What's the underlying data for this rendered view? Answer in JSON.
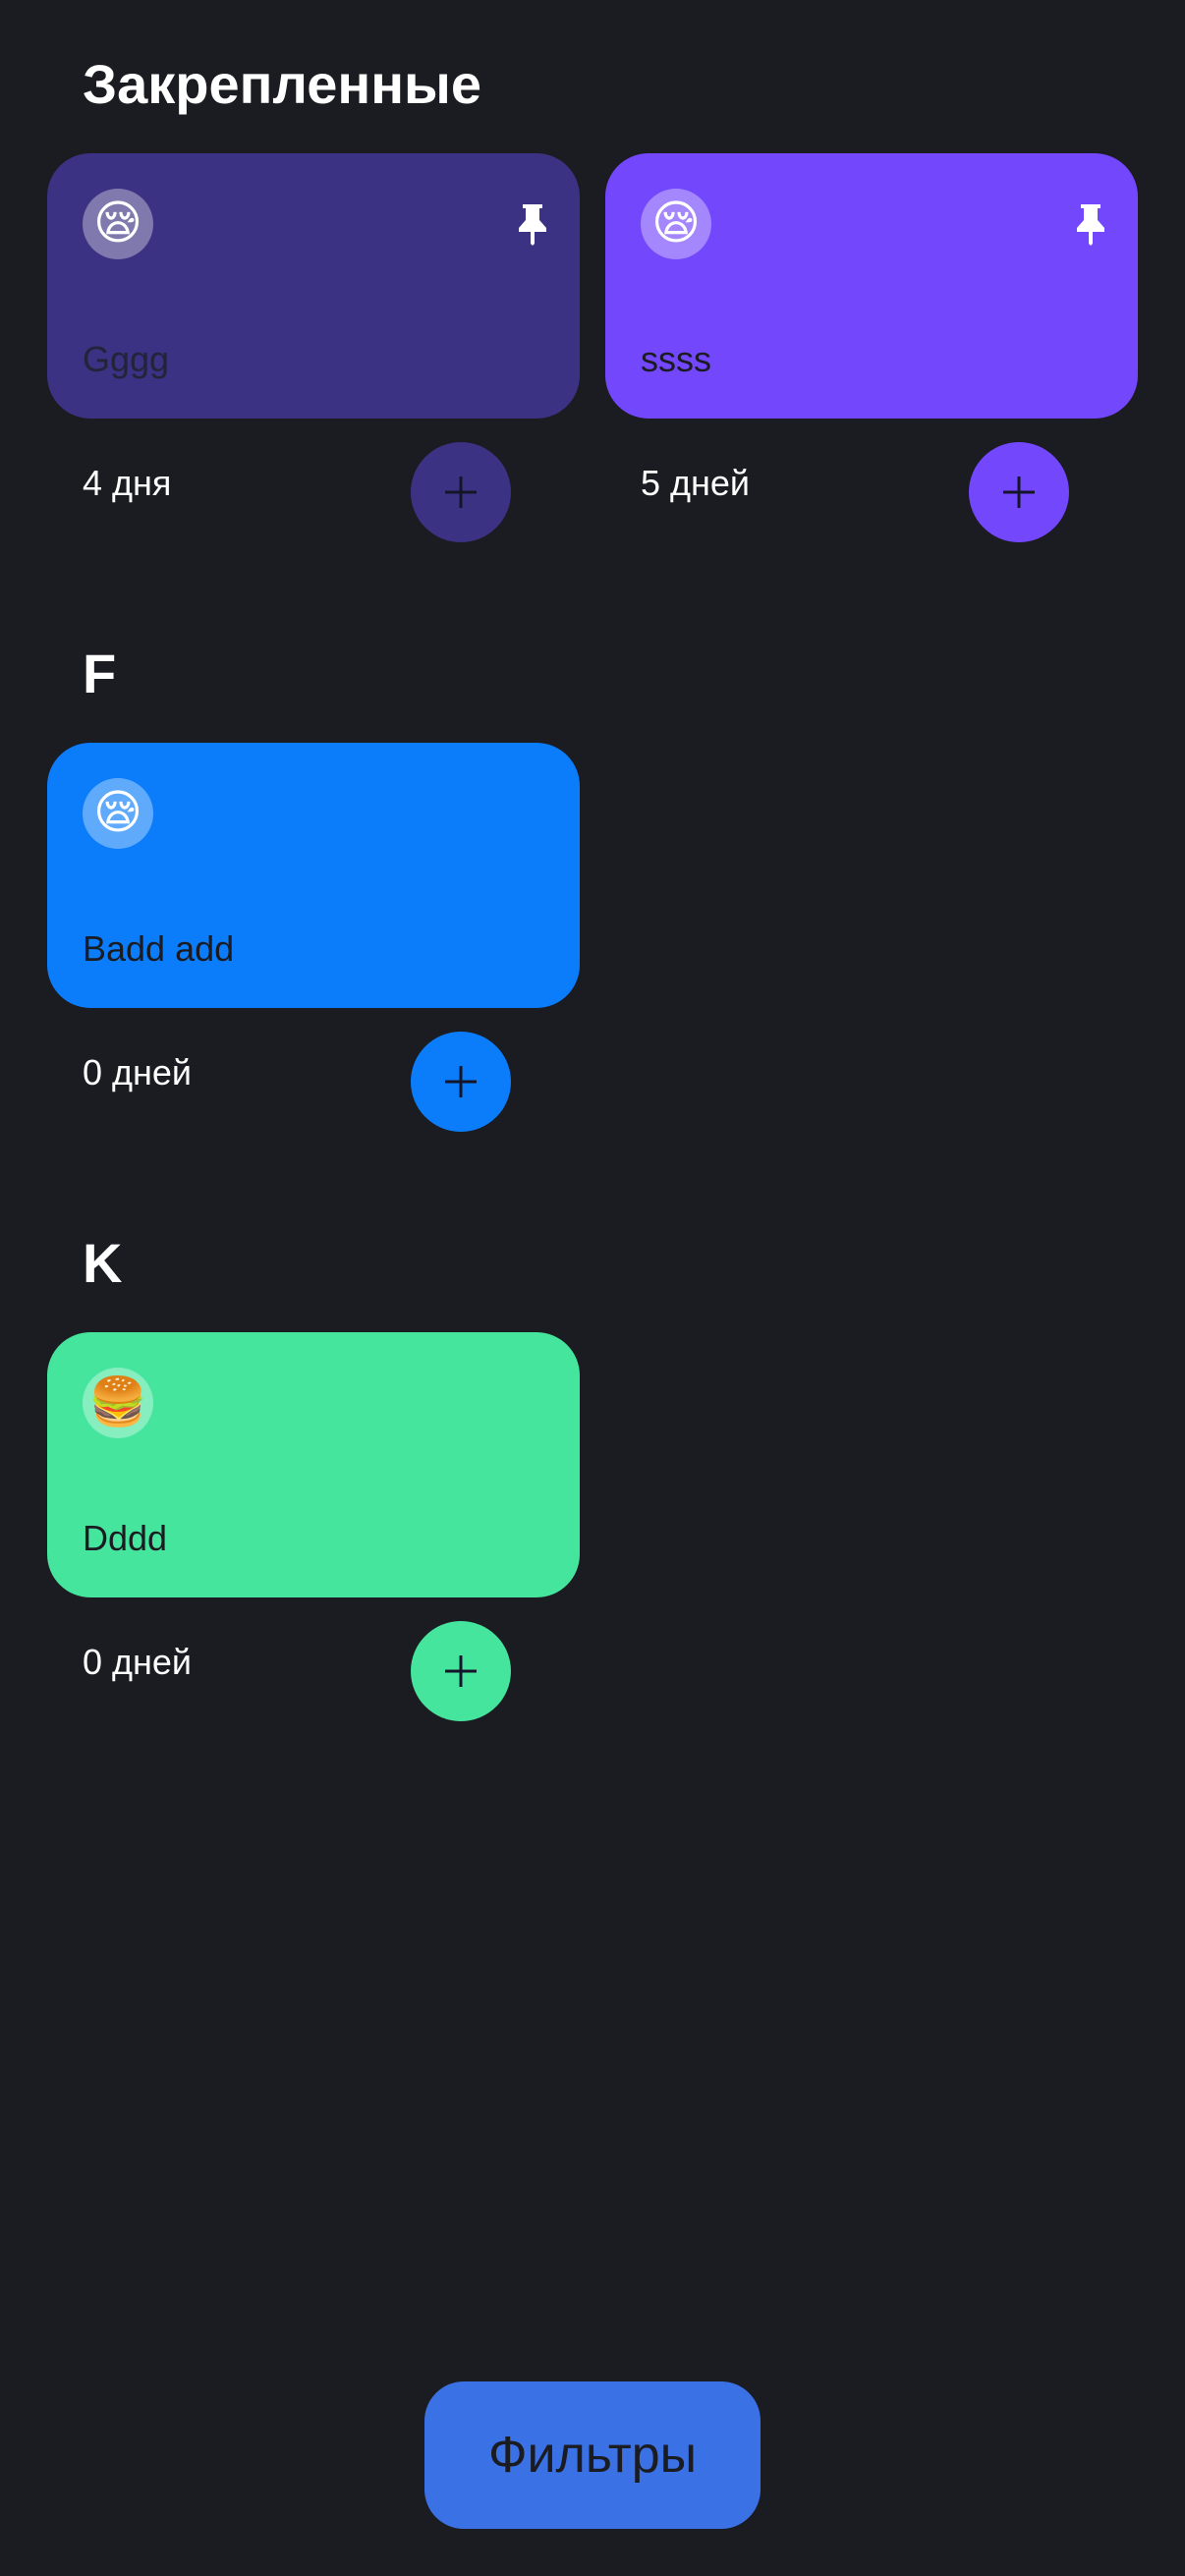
{
  "sections": {
    "pinned": {
      "title": "Закрепленные"
    },
    "f": {
      "title": "F"
    },
    "k": {
      "title": "K"
    }
  },
  "trackers": [
    {
      "name": "Gggg",
      "counter": "4 дня",
      "emoji": "😪",
      "color": "#3b3283",
      "pinned": true
    },
    {
      "name": "ssss",
      "counter": "5 дней",
      "emoji": "😪",
      "color": "#7347fb",
      "pinned": true
    },
    {
      "name": "Badd add",
      "counter": "0 дней",
      "emoji": "😪",
      "color": "#0b7dfb",
      "pinned": false
    },
    {
      "name": "Dddd",
      "counter": "0 дней",
      "emoji": "🍔",
      "color": "#46e59d",
      "pinned": false
    }
  ],
  "icons": {
    "pin": "pin-icon",
    "add": "plus-icon"
  },
  "filter_button": {
    "label": "Фильтры",
    "color": "#3a72e6"
  },
  "background": "#1b1b22"
}
